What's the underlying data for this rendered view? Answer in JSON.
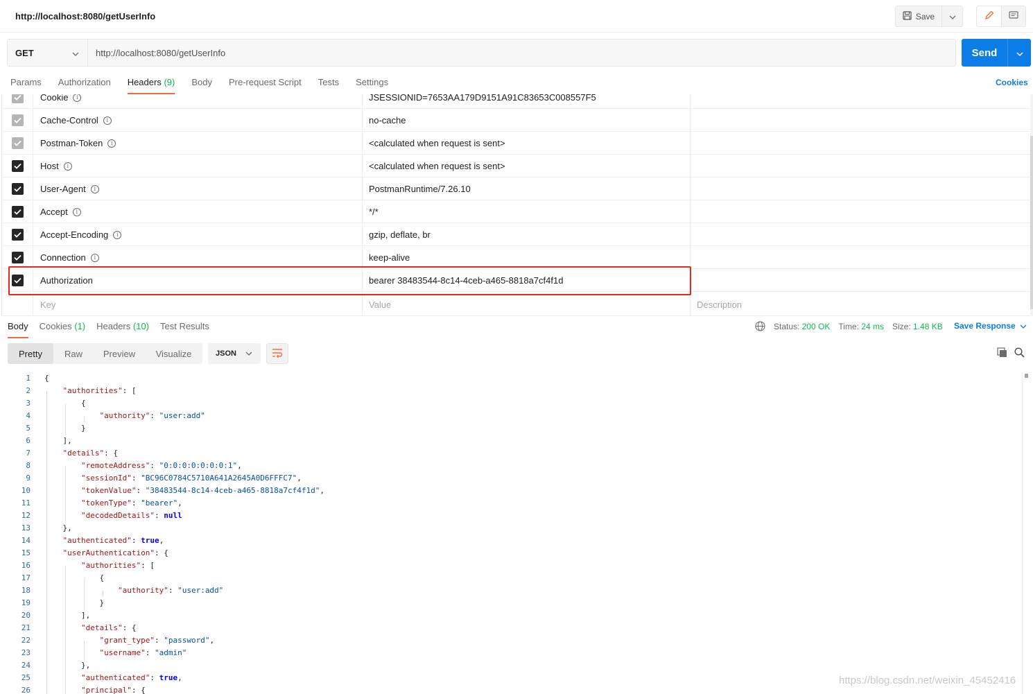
{
  "title_bar": {
    "tab_title": "http://localhost:8080/getUserInfo",
    "save_label": "Save"
  },
  "request": {
    "method": "GET",
    "url": "http://localhost:8080/getUserInfo",
    "send_label": "Send"
  },
  "request_tabs": {
    "params": "Params",
    "authorization": "Authorization",
    "headers": "Headers",
    "headers_count": "(9)",
    "body": "Body",
    "pre_request": "Pre-request Script",
    "tests": "Tests",
    "settings": "Settings",
    "cookies": "Cookies",
    "active": "Headers"
  },
  "headers": [
    {
      "key": "Cookie",
      "value": "JSESSIONID=7653AA179D9151A91C83653C008557F5",
      "checked": true,
      "auto": true
    },
    {
      "key": "Cache-Control",
      "value": "no-cache",
      "checked": true,
      "auto": true
    },
    {
      "key": "Postman-Token",
      "value": "<calculated when request is sent>",
      "checked": true,
      "auto": true
    },
    {
      "key": "Host",
      "value": "<calculated when request is sent>",
      "checked": true,
      "auto": false
    },
    {
      "key": "User-Agent",
      "value": "PostmanRuntime/7.26.10",
      "checked": true,
      "auto": false
    },
    {
      "key": "Accept",
      "value": "*/*",
      "checked": true,
      "auto": false
    },
    {
      "key": "Accept-Encoding",
      "value": "gzip, deflate, br",
      "checked": true,
      "auto": false
    },
    {
      "key": "Connection",
      "value": "keep-alive",
      "checked": true,
      "auto": false
    },
    {
      "key": "Authorization",
      "value": "bearer 38483544-8c14-4ceb-a465-8818a7cf4f1d",
      "checked": true,
      "auto": false
    }
  ],
  "header_placeholders": {
    "key": "Key",
    "value": "Value",
    "description": "Description"
  },
  "response_tabs": {
    "body": "Body",
    "cookies": "Cookies",
    "cookies_count": "(1)",
    "headers": "Headers",
    "headers_count": "(10)",
    "test_results": "Test Results",
    "active": "Body"
  },
  "response_status": {
    "status_label": "Status:",
    "status": "200 OK",
    "time_label": "Time:",
    "time": "24 ms",
    "size_label": "Size:",
    "size": "1.48 KB",
    "save_response": "Save Response"
  },
  "response_view": {
    "modes": [
      "Pretty",
      "Raw",
      "Preview",
      "Visualize"
    ],
    "active_mode": "Pretty",
    "format": "JSON"
  },
  "colors": {
    "accent_orange": "#f26b3a",
    "send_blue": "#0c7ce6",
    "status_green": "#0cbb52",
    "highlight_red": "#e8251f"
  },
  "icons": [
    "save-icon",
    "chevron-down-icon",
    "pencil-icon",
    "comment-icon",
    "info-icon",
    "check-icon",
    "globe-icon",
    "wrap-lines-icon",
    "copy-icon",
    "search-icon"
  ],
  "code_lines": [
    "{",
    "    \"authorities\": [",
    "        {",
    "            \"authority\": \"user:add\"",
    "        }",
    "    ],",
    "    \"details\": {",
    "        \"remoteAddress\": \"0:0:0:0:0:0:0:1\",",
    "        \"sessionId\": \"BC96C0784C5710A641A2645A0D6FFFC7\",",
    "        \"tokenValue\": \"38483544-8c14-4ceb-a465-8818a7cf4f1d\",",
    "        \"tokenType\": \"bearer\",",
    "        \"decodedDetails\": null",
    "    },",
    "    \"authenticated\": true,",
    "    \"userAuthentication\": {",
    "        \"authorities\": [",
    "            {",
    "                \"authority\": \"user:add\"",
    "            }",
    "        ],",
    "        \"details\": {",
    "            \"grant_type\": \"password\",",
    "            \"username\": \"admin\"",
    "        },",
    "        \"authenticated\": true,",
    "        \"principal\": {"
  ],
  "watermark": "https://blog.csdn.net/weixin_45452416"
}
